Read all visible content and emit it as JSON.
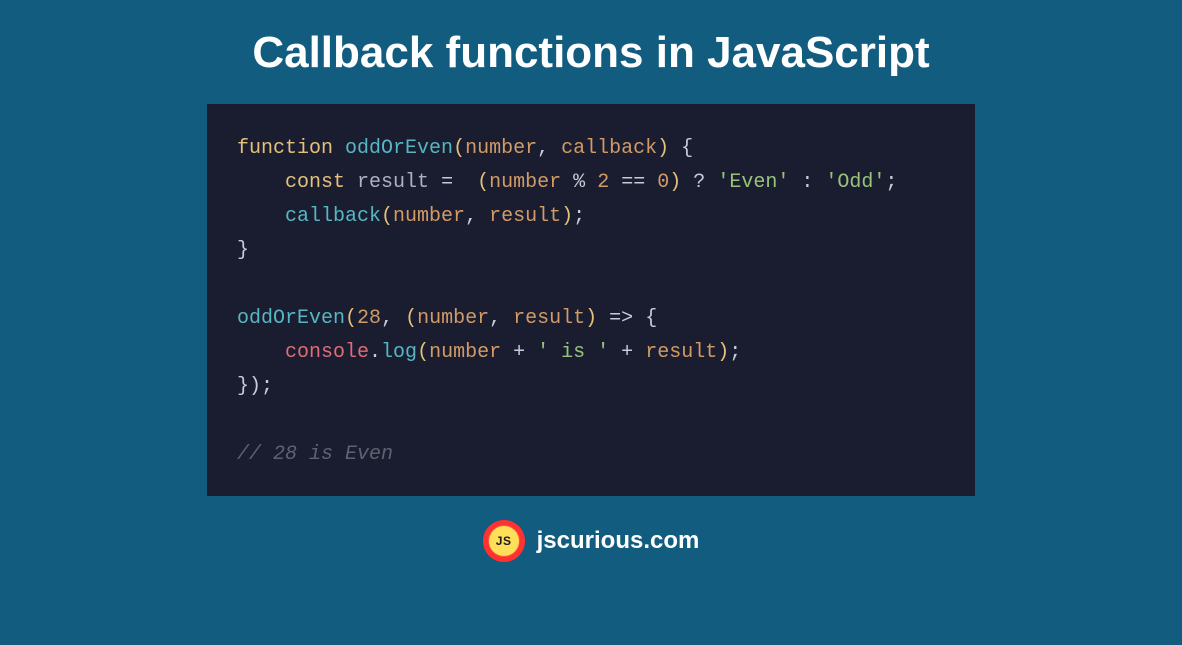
{
  "title": "Callback functions in JavaScript",
  "code": {
    "l1": {
      "kw": "function",
      "fn": "oddOrEven",
      "p1": "number",
      "p2": "callback"
    },
    "l2": {
      "kw": "const",
      "var": "result",
      "eq": "=",
      "p1": "number",
      "mod": "%",
      "n2": "2",
      "eqeq": "==",
      "n0": "0",
      "q": "?",
      "s1": "'Even'",
      "colon": ":",
      "s2": "'Odd'"
    },
    "l3": {
      "call": "callback",
      "a1": "number",
      "a2": "result"
    },
    "l5": {
      "call": "oddOrEven",
      "n": "28",
      "p1": "number",
      "p2": "result",
      "arrow": "=>"
    },
    "l6": {
      "obj": "console",
      "method": "log",
      "a1": "number",
      "s1": "' is '",
      "a2": "result"
    },
    "comment": "// 28 is Even"
  },
  "footer": {
    "logo_text": "JS",
    "site": "jscurious.com"
  }
}
